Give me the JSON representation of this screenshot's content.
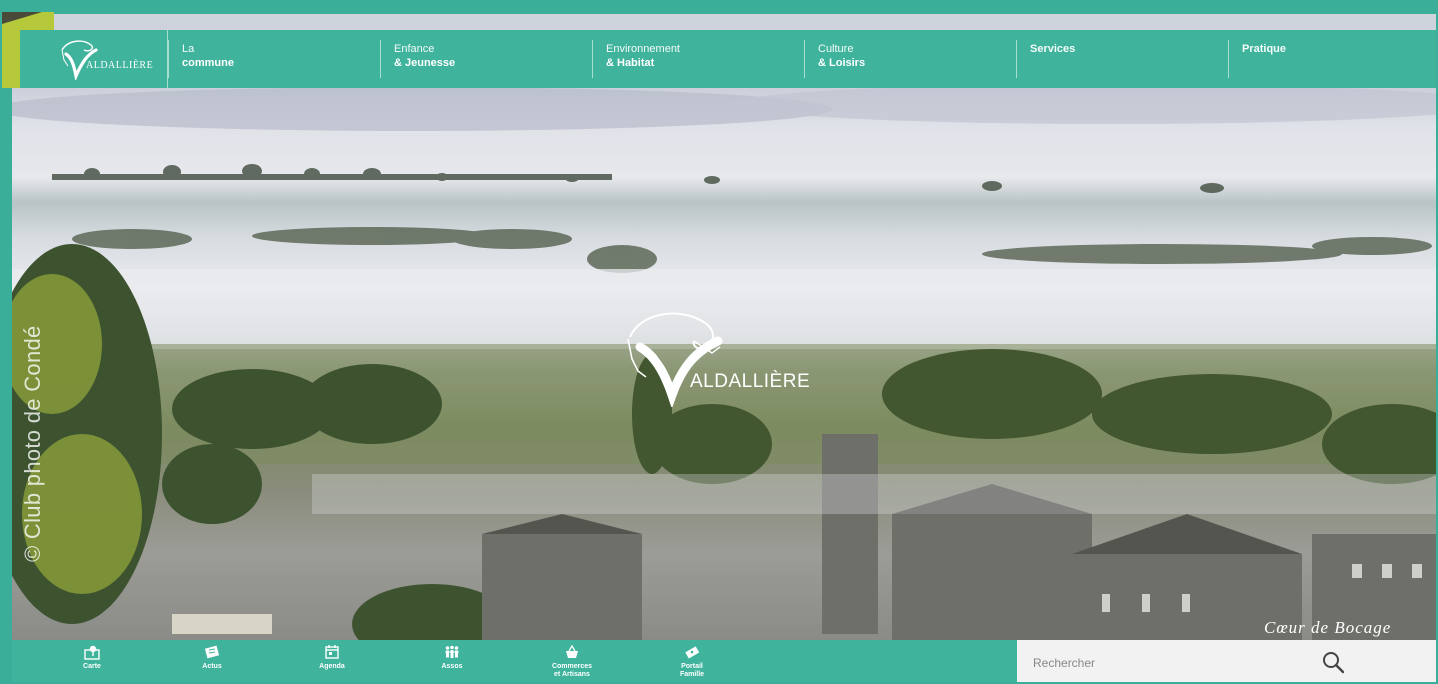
{
  "brand": {
    "logo_text": "ALDALLIÈRE",
    "center_logo_text": "ALDALLIÈRE"
  },
  "nav": {
    "items": [
      {
        "line1": "La",
        "line2": "commune"
      },
      {
        "line1": "Enfance",
        "line2": "& Jeunesse"
      },
      {
        "line1": "Environnement",
        "line2": "& Habitat"
      },
      {
        "line1": "Culture",
        "line2": "& Loisirs"
      },
      {
        "line1": "Services",
        "line2": ""
      },
      {
        "line1": "Pratique",
        "line2": ""
      }
    ]
  },
  "hero": {
    "photo_credit": "© Club photo de Condé",
    "tagline": "Cœur de Bocage"
  },
  "quick_links": [
    {
      "line1": "Carte",
      "line2": "",
      "icon": "map-icon"
    },
    {
      "line1": "Actus",
      "line2": "",
      "icon": "newspaper-icon"
    },
    {
      "line1": "Agenda",
      "line2": "",
      "icon": "calendar-icon"
    },
    {
      "line1": "Assos",
      "line2": "",
      "icon": "people-icon"
    },
    {
      "line1": "Commerces",
      "line2": "et Artisans",
      "icon": "shop-basket-icon"
    },
    {
      "line1": "Portail",
      "line2": "Famille",
      "icon": "ticket-icon"
    }
  ],
  "search": {
    "placeholder": "Rechercher"
  },
  "colors": {
    "primary": "#3fb39c",
    "accent": "#b6c93a",
    "search_bg": "#f2f2f2"
  }
}
